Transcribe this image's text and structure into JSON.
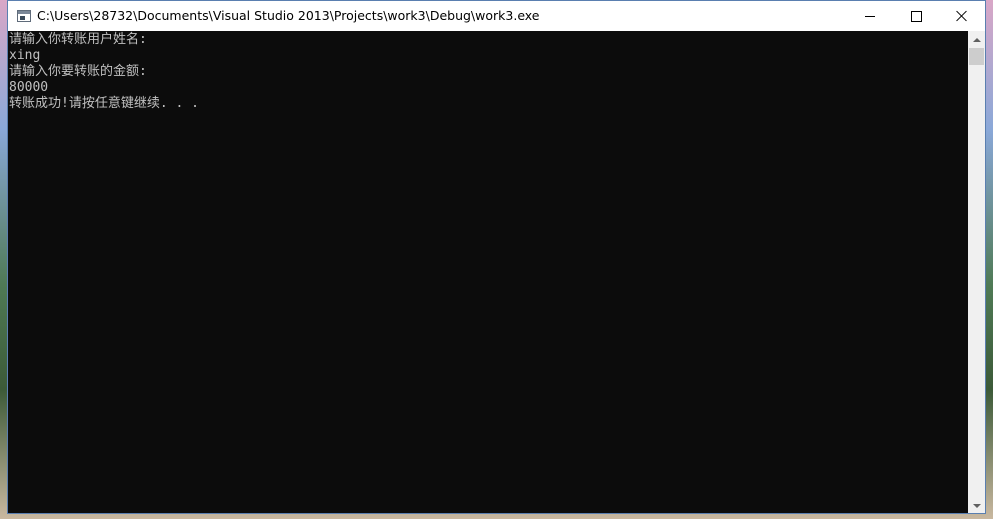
{
  "window": {
    "title": "C:\\Users\\28732\\Documents\\Visual Studio 2013\\Projects\\work3\\Debug\\work3.exe"
  },
  "titlebar": {
    "app_icon": "console-app-icon",
    "minimize_icon": "minimize-icon",
    "maximize_icon": "maximize-icon",
    "close_icon": "close-icon"
  },
  "console": {
    "lines": [
      "请输入你转账用户姓名:",
      "xing",
      "请输入你要转账的金额:",
      "80000",
      "转账成功!请按任意键继续. . ."
    ]
  },
  "scrollbar": {
    "up_icon": "scroll-up-arrow-icon",
    "down_icon": "scroll-down-arrow-icon"
  }
}
